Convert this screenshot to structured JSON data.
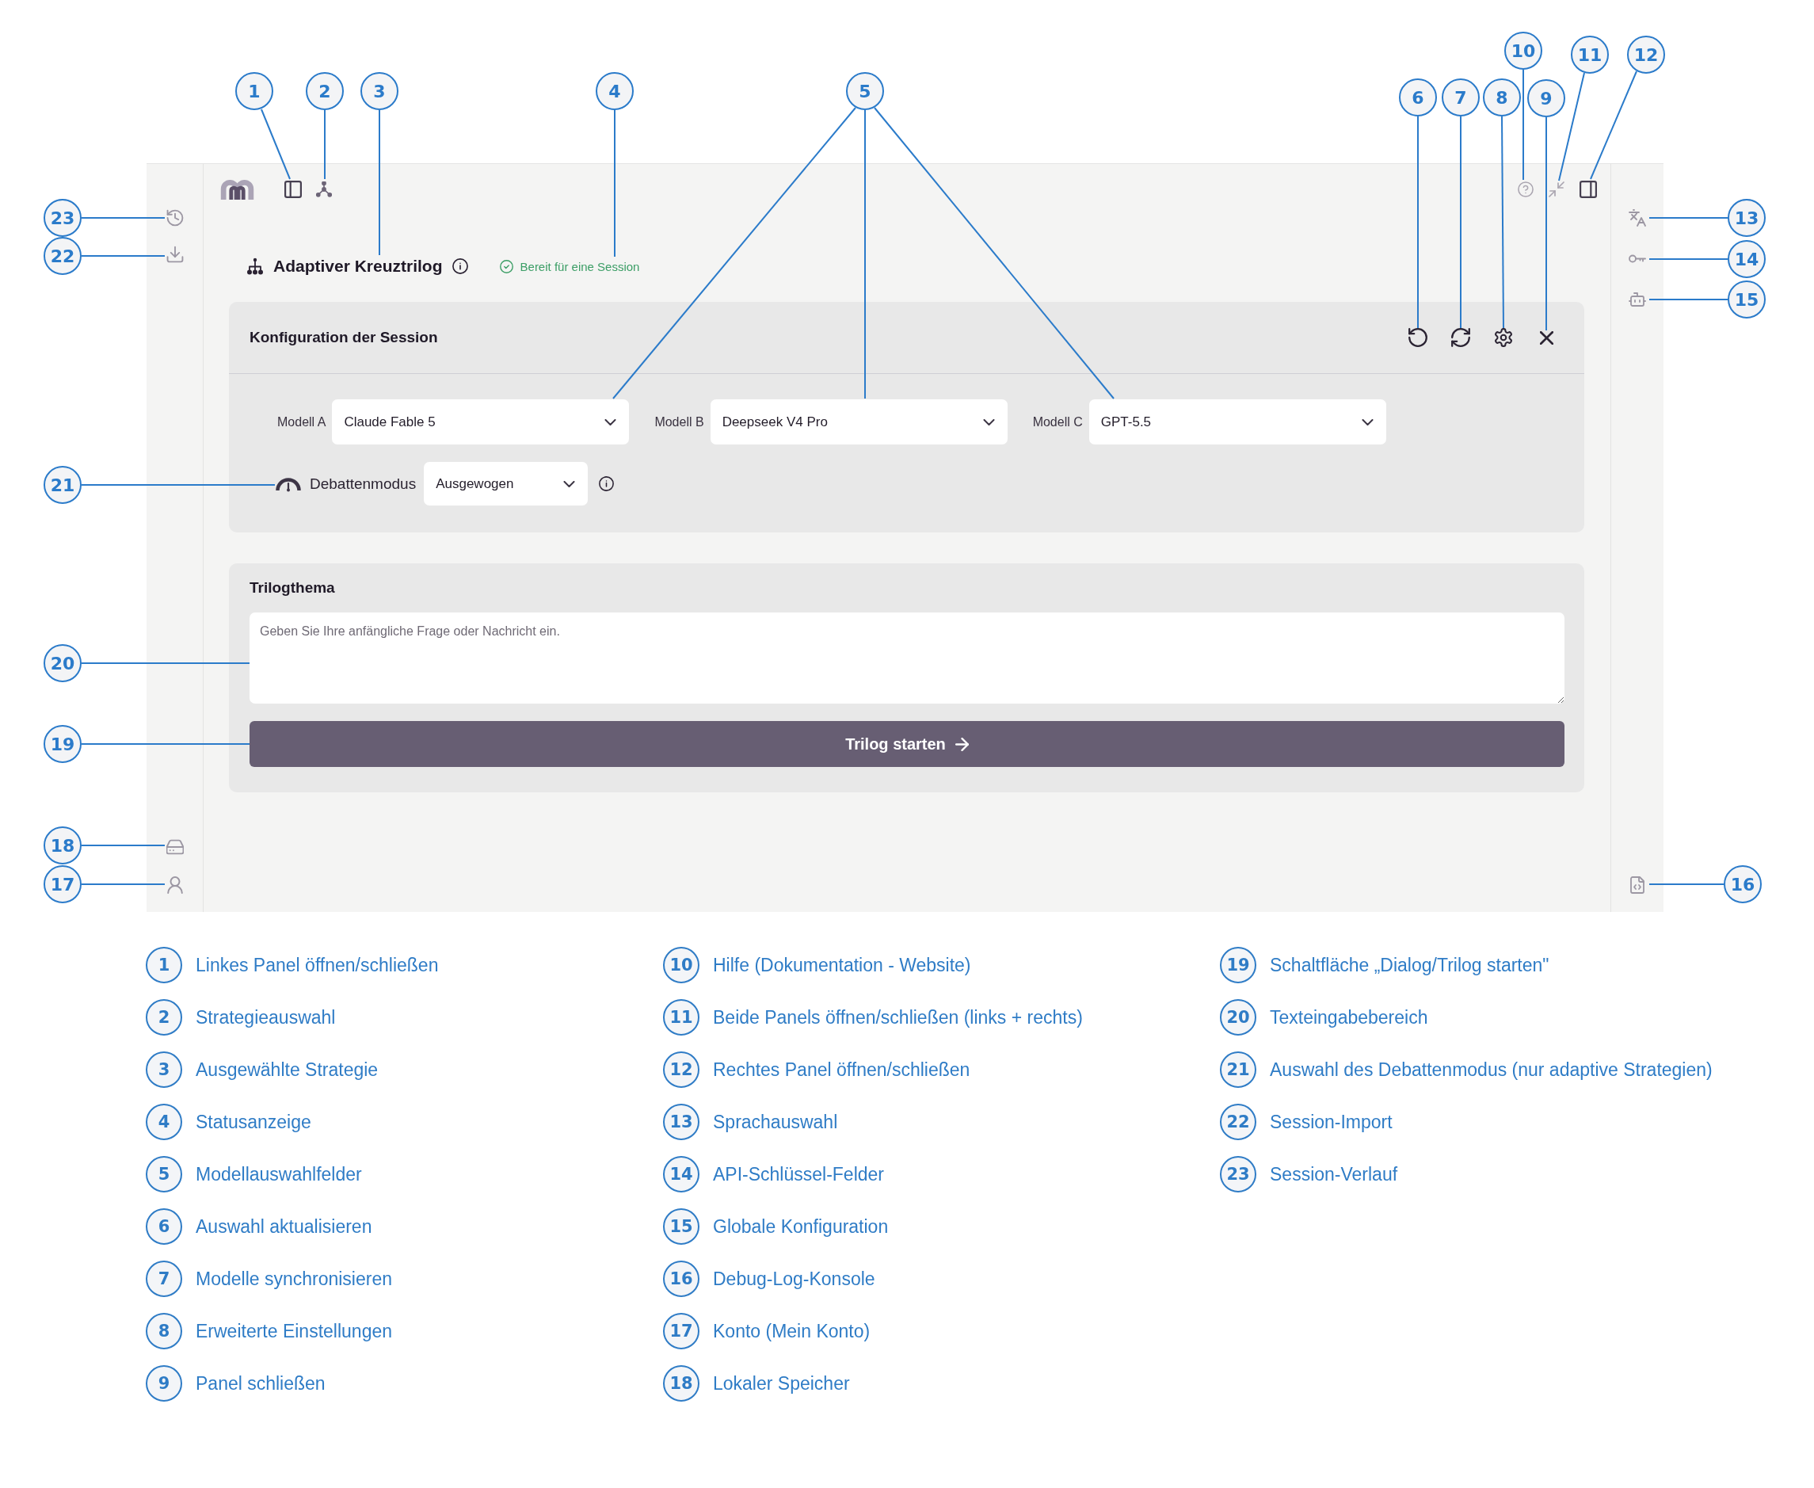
{
  "app": {
    "strategy": {
      "title": "Adaptiver Kreuztrilog"
    },
    "status": {
      "text": "Bereit für eine Session"
    },
    "config_panel": {
      "title": "Konfiguration der Session",
      "models": [
        {
          "label": "Modell A",
          "value": "Claude Fable 5"
        },
        {
          "label": "Modell B",
          "value": "Deepseek V4 Pro"
        },
        {
          "label": "Modell C",
          "value": "GPT-5.5"
        }
      ],
      "debate_mode": {
        "label": "Debattenmodus",
        "value": "Ausgewogen"
      }
    },
    "topic_panel": {
      "title": "Trilogthema",
      "input": {
        "placeholder": "Geben Sie Ihre anfängliche Frage oder Nachricht ein."
      },
      "start_button": {
        "label": "Trilog starten"
      }
    }
  },
  "callouts": [
    "10",
    "11",
    "12",
    "1",
    "2",
    "3",
    "4",
    "5",
    "6",
    "7",
    "8",
    "9",
    "23",
    "13",
    "22",
    "14",
    "15",
    "21",
    "20",
    "19",
    "18",
    "17",
    "16"
  ],
  "legend": [
    {
      "number": "1",
      "label": "Linkes Panel öffnen/schließen"
    },
    {
      "number": "2",
      "label": "Strategieauswahl"
    },
    {
      "number": "3",
      "label": "Ausgewählte Strategie"
    },
    {
      "number": "4",
      "label": "Statusanzeige"
    },
    {
      "number": "5",
      "label": "Modellauswahlfelder"
    },
    {
      "number": "6",
      "label": "Auswahl aktualisieren"
    },
    {
      "number": "7",
      "label": "Modelle synchronisieren"
    },
    {
      "number": "8",
      "label": "Erweiterte Einstellungen"
    },
    {
      "number": "9",
      "label": "Panel schließen"
    },
    {
      "number": "10",
      "label": "Hilfe (Dokumentation - Website)"
    },
    {
      "number": "11",
      "label": "Beide Panels öffnen/schließen (links + rechts)"
    },
    {
      "number": "12",
      "label": "Rechtes Panel öffnen/schließen"
    },
    {
      "number": "13",
      "label": "Sprachauswahl"
    },
    {
      "number": "14",
      "label": "API-Schlüssel-Felder"
    },
    {
      "number": "15",
      "label": "Globale Konfiguration"
    },
    {
      "number": "16",
      "label": "Debug-Log-Konsole"
    },
    {
      "number": "17",
      "label": "Konto (Mein Konto)"
    },
    {
      "number": "18",
      "label": "Lokaler Speicher"
    },
    {
      "number": "19",
      "label": "Schaltfläche „Dialog/Trilog starten\""
    },
    {
      "number": "20",
      "label": "Texteingabebereich"
    },
    {
      "number": "21",
      "label": "Auswahl des Debattenmodus (nur adaptive Strategien)"
    },
    {
      "number": "22",
      "label": "Session-Import"
    },
    {
      "number": "23",
      "label": "Session-Verlauf"
    }
  ]
}
